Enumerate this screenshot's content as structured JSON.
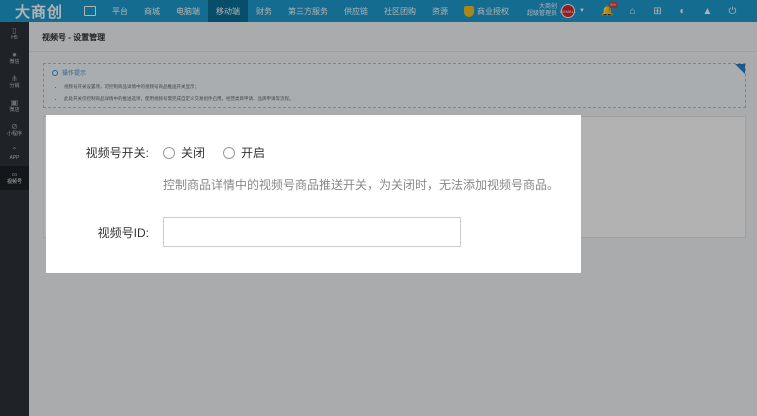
{
  "topbar": {
    "logo": "大商创",
    "nav": [
      "平台",
      "商城",
      "电脑端",
      "移动端",
      "财务",
      "第三方服务",
      "供应链",
      "社区团购",
      "资源"
    ],
    "active_nav": "移动端",
    "auth_label": "商业授权",
    "user_line1": "大商创",
    "user_line2": "超级管理员",
    "avatar_text": "DSMALL",
    "notification_badge": "99+"
  },
  "sidebar": {
    "items": [
      {
        "label": "H5",
        "icon": "phone-icon"
      },
      {
        "label": "微信",
        "icon": "wechat-icon"
      },
      {
        "label": "分销",
        "icon": "distribution-icon"
      },
      {
        "label": "微店",
        "icon": "shop-icon"
      },
      {
        "label": "小程序",
        "icon": "miniprogram-icon"
      },
      {
        "label": "APP",
        "icon": "app-icon"
      },
      {
        "label": "视频号",
        "icon": "video-channel-icon"
      }
    ],
    "active": "视频号"
  },
  "breadcrumb": "视频号 - 设置管理",
  "tips": {
    "title": "操作提示",
    "items": [
      "视频号开关设置项，可控制商品详情中的视频号商品推送开关显示；",
      "此处开关仅控制商品详情中的推送选项，使用视频号需完成自定义交易组件启用，经营类目申请、品牌申请等流程。"
    ]
  },
  "modal": {
    "switch_label": "视频号开关:",
    "option_off": "关闭",
    "option_on": "开启",
    "hint": "控制商品详情中的视频号商品推送开关，为关闭时，无法添加视频号商品。",
    "id_label": "视频号ID:",
    "id_value": ""
  },
  "colors": {
    "topbar": "#1e9bd0",
    "topbar_active": "#0c6f98",
    "sidebar": "#2d3339",
    "tips_accent": "#3b8fd4"
  }
}
